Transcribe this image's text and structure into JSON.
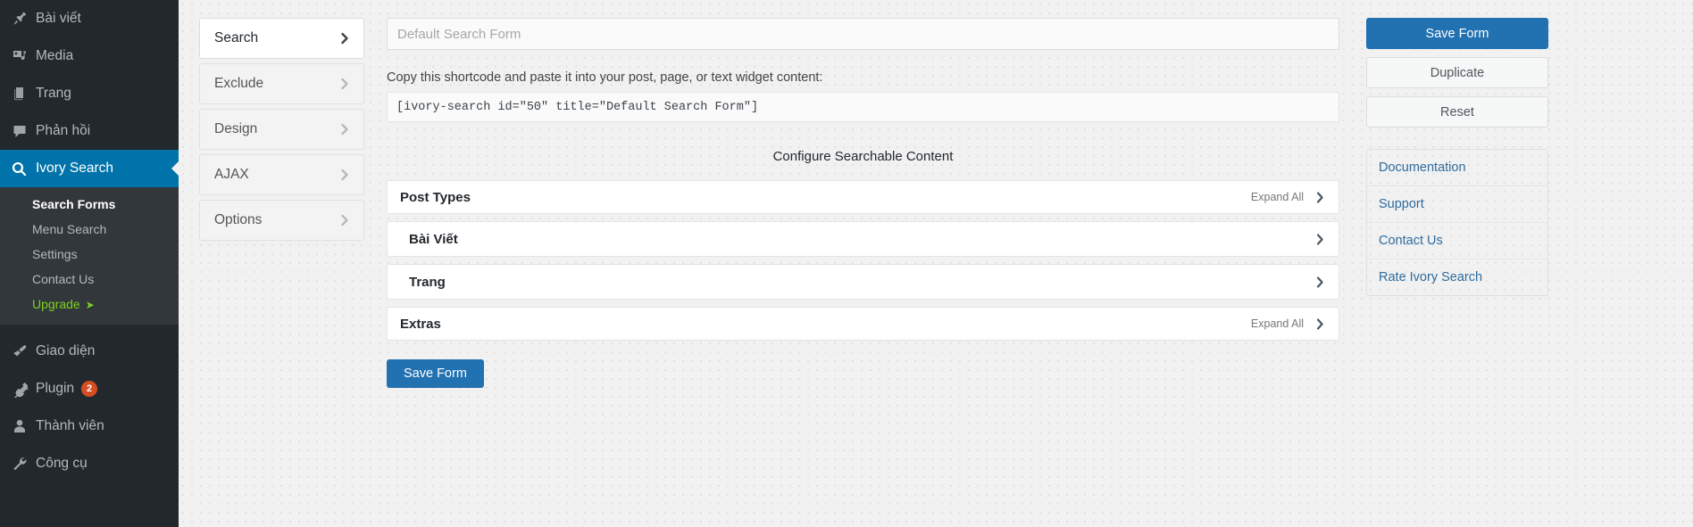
{
  "colors": {
    "sidebar_bg": "#23282d",
    "sidebar_submenu_bg": "#32373c",
    "accent_blue": "#0073aa",
    "button_blue": "#2271b1",
    "upgrade_green": "#7ed01e",
    "badge_red": "#d54e21",
    "link_blue": "#2e6b9e"
  },
  "sidebar": {
    "items": [
      {
        "label": "Bài viết",
        "icon": "pin-icon",
        "current": false
      },
      {
        "label": "Media",
        "icon": "media-icon",
        "current": false
      },
      {
        "label": "Trang",
        "icon": "pages-icon",
        "current": false
      },
      {
        "label": "Phản hồi",
        "icon": "comment-icon",
        "current": false
      },
      {
        "label": "Ivory Search",
        "icon": "search-icon",
        "current": true
      }
    ],
    "submenu": [
      {
        "label": "Search Forms",
        "current": true
      },
      {
        "label": "Menu Search",
        "current": false
      },
      {
        "label": "Settings",
        "current": false
      },
      {
        "label": "Contact Us",
        "current": false
      },
      {
        "label": "Upgrade",
        "current": false,
        "upgrade": true,
        "arrow": "➤"
      }
    ],
    "items_bottom": [
      {
        "label": "Giao diện",
        "icon": "appearance-icon",
        "badge": null
      },
      {
        "label": "Plugin",
        "icon": "plugin-icon",
        "badge": "2"
      },
      {
        "label": "Thành viên",
        "icon": "users-icon",
        "badge": null
      },
      {
        "label": "Công cụ",
        "icon": "tools-icon",
        "badge": null
      }
    ]
  },
  "tabs": [
    {
      "label": "Search",
      "active": true
    },
    {
      "label": "Exclude",
      "active": false
    },
    {
      "label": "Design",
      "active": false
    },
    {
      "label": "AJAX",
      "active": false
    },
    {
      "label": "Options",
      "active": false
    }
  ],
  "form": {
    "title_value": "",
    "title_placeholder": "Default Search Form",
    "shortcode_desc": "Copy this shortcode and paste it into your post, page, or text widget content:",
    "shortcode": "[ivory-search id=\"50\" title=\"Default Search Form\"]",
    "config_heading": "Configure Searchable Content",
    "save_label": "Save Form"
  },
  "accordion": [
    {
      "title": "Post Types",
      "expand_all": "Expand All",
      "nested": false
    },
    {
      "title": "Bài Viết",
      "expand_all": "",
      "nested": true
    },
    {
      "title": "Trang",
      "expand_all": "",
      "nested": true
    },
    {
      "title": "Extras",
      "expand_all": "Expand All",
      "nested": false
    }
  ],
  "actions": {
    "save_label": "Save Form",
    "duplicate_label": "Duplicate",
    "reset_label": "Reset"
  },
  "links": [
    {
      "label": "Documentation"
    },
    {
      "label": "Support"
    },
    {
      "label": "Contact Us"
    },
    {
      "label": "Rate Ivory Search"
    }
  ]
}
